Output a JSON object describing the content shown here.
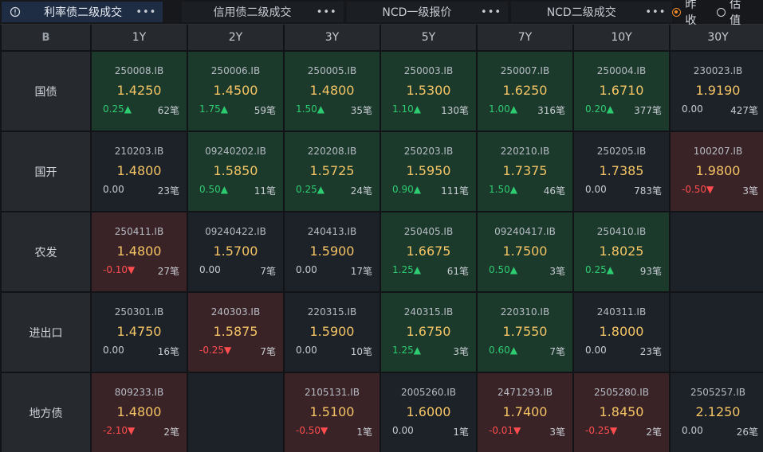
{
  "tabs": [
    {
      "label": "利率债二级成交",
      "active": true
    },
    {
      "label": "信用债二级成交",
      "active": false
    },
    {
      "label": "NCD一级报价",
      "active": false
    },
    {
      "label": "NCD二级成交",
      "active": false
    }
  ],
  "more_glyph": "•••",
  "radios": [
    {
      "label": "昨收",
      "selected": true
    },
    {
      "label": "估值",
      "selected": false
    }
  ],
  "corner_label": "B",
  "columns": [
    "1Y",
    "2Y",
    "3Y",
    "5Y",
    "7Y",
    "10Y",
    "30Y"
  ],
  "rows": [
    {
      "label": "国债",
      "cells": [
        {
          "code": "250008.IB",
          "yield": "1.4250",
          "change": "0.25▲",
          "count": "62笔",
          "trend": "up"
        },
        {
          "code": "250006.IB",
          "yield": "1.4500",
          "change": "1.75▲",
          "count": "59笔",
          "trend": "up"
        },
        {
          "code": "250005.IB",
          "yield": "1.4800",
          "change": "1.50▲",
          "count": "35笔",
          "trend": "up"
        },
        {
          "code": "250003.IB",
          "yield": "1.5300",
          "change": "1.10▲",
          "count": "130笔",
          "trend": "up"
        },
        {
          "code": "250007.IB",
          "yield": "1.6250",
          "change": "1.00▲",
          "count": "316笔",
          "trend": "up"
        },
        {
          "code": "250004.IB",
          "yield": "1.6710",
          "change": "0.20▲",
          "count": "377笔",
          "trend": "up"
        },
        {
          "code": "230023.IB",
          "yield": "1.9190",
          "change": "0.00",
          "count": "427笔",
          "trend": "neutral"
        }
      ]
    },
    {
      "label": "国开",
      "cells": [
        {
          "code": "210203.IB",
          "yield": "1.4800",
          "change": "0.00",
          "count": "23笔",
          "trend": "neutral"
        },
        {
          "code": "09240202.IB",
          "yield": "1.5850",
          "change": "0.50▲",
          "count": "11笔",
          "trend": "up"
        },
        {
          "code": "220208.IB",
          "yield": "1.5725",
          "change": "0.25▲",
          "count": "24笔",
          "trend": "up"
        },
        {
          "code": "250203.IB",
          "yield": "1.5950",
          "change": "0.90▲",
          "count": "111笔",
          "trend": "up"
        },
        {
          "code": "220210.IB",
          "yield": "1.7375",
          "change": "1.50▲",
          "count": "46笔",
          "trend": "up"
        },
        {
          "code": "250205.IB",
          "yield": "1.7385",
          "change": "0.00",
          "count": "783笔",
          "trend": "neutral"
        },
        {
          "code": "100207.IB",
          "yield": "1.9800",
          "change": "-0.50▼",
          "count": "3笔",
          "trend": "down"
        }
      ]
    },
    {
      "label": "农发",
      "cells": [
        {
          "code": "250411.IB",
          "yield": "1.4800",
          "change": "-0.10▼",
          "count": "27笔",
          "trend": "down"
        },
        {
          "code": "09240422.IB",
          "yield": "1.5700",
          "change": "0.00",
          "count": "7笔",
          "trend": "neutral"
        },
        {
          "code": "240413.IB",
          "yield": "1.5900",
          "change": "0.00",
          "count": "17笔",
          "trend": "neutral"
        },
        {
          "code": "250405.IB",
          "yield": "1.6675",
          "change": "1.25▲",
          "count": "61笔",
          "trend": "up"
        },
        {
          "code": "09240417.IB",
          "yield": "1.7500",
          "change": "0.50▲",
          "count": "3笔",
          "trend": "up"
        },
        {
          "code": "250410.IB",
          "yield": "1.8025",
          "change": "0.25▲",
          "count": "93笔",
          "trend": "up"
        },
        null
      ]
    },
    {
      "label": "进出口",
      "cells": [
        {
          "code": "250301.IB",
          "yield": "1.4750",
          "change": "0.00",
          "count": "16笔",
          "trend": "neutral"
        },
        {
          "code": "240303.IB",
          "yield": "1.5875",
          "change": "-0.25▼",
          "count": "7笔",
          "trend": "down"
        },
        {
          "code": "220315.IB",
          "yield": "1.5900",
          "change": "0.00",
          "count": "10笔",
          "trend": "neutral"
        },
        {
          "code": "240315.IB",
          "yield": "1.6750",
          "change": "1.25▲",
          "count": "3笔",
          "trend": "up"
        },
        {
          "code": "220310.IB",
          "yield": "1.7550",
          "change": "0.60▲",
          "count": "7笔",
          "trend": "up"
        },
        {
          "code": "240311.IB",
          "yield": "1.8000",
          "change": "0.00",
          "count": "23笔",
          "trend": "neutral"
        },
        null
      ]
    },
    {
      "label": "地方债",
      "cells": [
        {
          "code": "809233.IB",
          "yield": "1.4800",
          "change": "-2.10▼",
          "count": "2笔",
          "trend": "down"
        },
        null,
        {
          "code": "2105131.IB",
          "yield": "1.5100",
          "change": "-0.50▼",
          "count": "1笔",
          "trend": "down"
        },
        {
          "code": "2005260.IB",
          "yield": "1.6000",
          "change": "0.00",
          "count": "1笔",
          "trend": "neutral"
        },
        {
          "code": "2471293.IB",
          "yield": "1.7400",
          "change": "-0.01▼",
          "count": "3笔",
          "trend": "down"
        },
        {
          "code": "2505280.IB",
          "yield": "1.8450",
          "change": "-0.25▼",
          "count": "2笔",
          "trend": "down"
        },
        {
          "code": "2505257.IB",
          "yield": "2.1250",
          "change": "0.00",
          "count": "26笔",
          "trend": "neutral"
        }
      ]
    }
  ]
}
